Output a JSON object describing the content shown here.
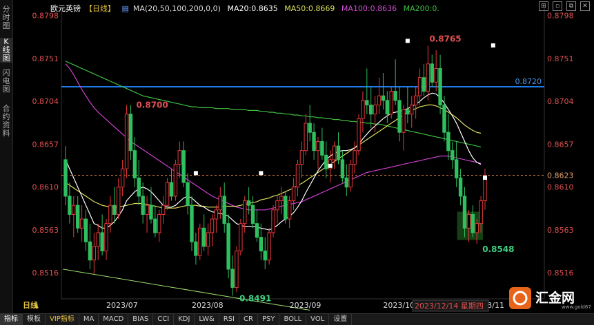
{
  "rail": {
    "items": [
      "分时图",
      "K线图",
      "闪电图",
      "合约资料"
    ],
    "active": 1
  },
  "header": {
    "symbol": "欧元英镑",
    "period": "【日线】",
    "ma_params": "MA(20,50,100,200,0,0)",
    "ma20": "MA20:0.8635",
    "ma50": "MA50:0.8669",
    "ma100": "MA100:0.8636",
    "ma200": "MA200:0."
  },
  "colors": {
    "up": "#e8383a",
    "down": "#2fbf5f",
    "ma20": "#ffffff",
    "ma50": "#e0e060",
    "ma100": "#d040d0",
    "ma200": "#40c040",
    "hline": "#1e7be8",
    "cur": "#e08040",
    "axis_text": "#e05050",
    "header_ma20": "#ffffff",
    "header_ma50": "#e0e060",
    "header_ma100": "#d050d0",
    "header_ma200": "#40c040"
  },
  "axis": {
    "y_ticks": [
      "0.8798",
      "0.8751",
      "0.8704",
      "0.8657",
      "0.8610",
      "0.8563",
      "0.8516"
    ],
    "y_min": 0.8489,
    "y_max": 0.8806,
    "x_labels": [
      "2023/07",
      "2023/08",
      "2023/09",
      "2023/10",
      "2023/11"
    ],
    "x_positions_idx": [
      10,
      31,
      55,
      78,
      100
    ],
    "period_label": "日线",
    "cursor_date": "2023/12/14 星期四"
  },
  "annotations": {
    "high_label": "0.8765",
    "low_label": "0.8491",
    "recent_low_label": "0.8548",
    "peak_label": "0.8700",
    "hline_label": "0.8720",
    "hline_value": 0.872,
    "current_label": "0.8623",
    "current_value": 0.8623
  },
  "chart_data": {
    "type": "candlestick",
    "ohlc": [
      [
        0.864,
        0.8655,
        0.859,
        0.86
      ],
      [
        0.86,
        0.8615,
        0.857,
        0.858
      ],
      [
        0.858,
        0.86,
        0.8555,
        0.859
      ],
      [
        0.859,
        0.86,
        0.856,
        0.8565
      ],
      [
        0.8565,
        0.859,
        0.855,
        0.8575
      ],
      [
        0.8575,
        0.8585,
        0.854,
        0.855
      ],
      [
        0.855,
        0.857,
        0.852,
        0.853
      ],
      [
        0.853,
        0.856,
        0.8515,
        0.8545
      ],
      [
        0.8545,
        0.857,
        0.853,
        0.856
      ],
      [
        0.856,
        0.858,
        0.8535,
        0.854
      ],
      [
        0.854,
        0.8575,
        0.853,
        0.857
      ],
      [
        0.857,
        0.86,
        0.856,
        0.859
      ],
      [
        0.859,
        0.861,
        0.857,
        0.858
      ],
      [
        0.858,
        0.862,
        0.8575,
        0.861
      ],
      [
        0.861,
        0.864,
        0.86,
        0.863
      ],
      [
        0.863,
        0.87,
        0.862,
        0.869
      ],
      [
        0.869,
        0.87,
        0.864,
        0.865
      ],
      [
        0.865,
        0.8665,
        0.861,
        0.862
      ],
      [
        0.862,
        0.864,
        0.859,
        0.86
      ],
      [
        0.86,
        0.8615,
        0.857,
        0.858
      ],
      [
        0.858,
        0.86,
        0.856,
        0.859
      ],
      [
        0.859,
        0.861,
        0.857,
        0.8575
      ],
      [
        0.8575,
        0.859,
        0.8555,
        0.856
      ],
      [
        0.856,
        0.8585,
        0.855,
        0.858
      ],
      [
        0.858,
        0.86,
        0.857,
        0.859
      ],
      [
        0.859,
        0.862,
        0.8585,
        0.8615
      ],
      [
        0.8615,
        0.863,
        0.8595,
        0.86
      ],
      [
        0.86,
        0.864,
        0.8595,
        0.8635
      ],
      [
        0.8635,
        0.866,
        0.862,
        0.865
      ],
      [
        0.865,
        0.866,
        0.861,
        0.8615
      ],
      [
        0.8615,
        0.8625,
        0.858,
        0.859
      ],
      [
        0.859,
        0.86,
        0.854,
        0.855
      ],
      [
        0.855,
        0.856,
        0.8525,
        0.8535
      ],
      [
        0.8535,
        0.857,
        0.853,
        0.8565
      ],
      [
        0.8565,
        0.858,
        0.854,
        0.8545
      ],
      [
        0.8545,
        0.857,
        0.8535,
        0.856
      ],
      [
        0.856,
        0.858,
        0.8545,
        0.8575
      ],
      [
        0.8575,
        0.859,
        0.856,
        0.8585
      ],
      [
        0.8585,
        0.861,
        0.8575,
        0.86
      ],
      [
        0.86,
        0.8615,
        0.856,
        0.857
      ],
      [
        0.857,
        0.858,
        0.851,
        0.852
      ],
      [
        0.852,
        0.8535,
        0.8491,
        0.85
      ],
      [
        0.85,
        0.8545,
        0.8495,
        0.854
      ],
      [
        0.854,
        0.8575,
        0.8535,
        0.857
      ],
      [
        0.857,
        0.86,
        0.856,
        0.8595
      ],
      [
        0.8595,
        0.861,
        0.858,
        0.859
      ],
      [
        0.859,
        0.86,
        0.8565,
        0.857
      ],
      [
        0.857,
        0.8585,
        0.855,
        0.8555
      ],
      [
        0.8555,
        0.857,
        0.853,
        0.854
      ],
      [
        0.854,
        0.8555,
        0.852,
        0.853
      ],
      [
        0.853,
        0.8565,
        0.8525,
        0.856
      ],
      [
        0.856,
        0.859,
        0.8555,
        0.8585
      ],
      [
        0.8585,
        0.86,
        0.857,
        0.8595
      ],
      [
        0.8595,
        0.861,
        0.858,
        0.86
      ],
      [
        0.86,
        0.8605,
        0.857,
        0.8575
      ],
      [
        0.8575,
        0.86,
        0.8565,
        0.8595
      ],
      [
        0.8595,
        0.862,
        0.8585,
        0.861
      ],
      [
        0.861,
        0.864,
        0.86,
        0.8635
      ],
      [
        0.8635,
        0.866,
        0.862,
        0.865
      ],
      [
        0.865,
        0.869,
        0.8645,
        0.868
      ],
      [
        0.868,
        0.87,
        0.866,
        0.867
      ],
      [
        0.867,
        0.868,
        0.864,
        0.865
      ],
      [
        0.865,
        0.8665,
        0.863,
        0.866
      ],
      [
        0.866,
        0.8675,
        0.864,
        0.8645
      ],
      [
        0.8645,
        0.866,
        0.862,
        0.863
      ],
      [
        0.863,
        0.865,
        0.8615,
        0.864
      ],
      [
        0.864,
        0.866,
        0.863,
        0.8655
      ],
      [
        0.8655,
        0.867,
        0.8635,
        0.864
      ],
      [
        0.864,
        0.865,
        0.8615,
        0.862
      ],
      [
        0.862,
        0.8635,
        0.86,
        0.861
      ],
      [
        0.861,
        0.864,
        0.8605,
        0.8635
      ],
      [
        0.8635,
        0.866,
        0.8625,
        0.865
      ],
      [
        0.865,
        0.869,
        0.8645,
        0.8685
      ],
      [
        0.8685,
        0.8715,
        0.867,
        0.8705
      ],
      [
        0.8705,
        0.874,
        0.869,
        0.87
      ],
      [
        0.87,
        0.872,
        0.8675,
        0.869
      ],
      [
        0.869,
        0.871,
        0.867,
        0.87
      ],
      [
        0.87,
        0.873,
        0.869,
        0.871
      ],
      [
        0.871,
        0.8735,
        0.8695,
        0.8705
      ],
      [
        0.8705,
        0.8715,
        0.868,
        0.869
      ],
      [
        0.869,
        0.872,
        0.8685,
        0.8715
      ],
      [
        0.8715,
        0.875,
        0.87,
        0.8705
      ],
      [
        0.8705,
        0.872,
        0.866,
        0.867
      ],
      [
        0.867,
        0.87,
        0.865,
        0.8695
      ],
      [
        0.8695,
        0.872,
        0.868,
        0.869
      ],
      [
        0.869,
        0.871,
        0.8675,
        0.87
      ],
      [
        0.87,
        0.872,
        0.8685,
        0.871
      ],
      [
        0.871,
        0.874,
        0.87,
        0.873
      ],
      [
        0.873,
        0.8745,
        0.871,
        0.8715
      ],
      [
        0.8715,
        0.8765,
        0.8705,
        0.8745
      ],
      [
        0.8745,
        0.8755,
        0.872,
        0.8725
      ],
      [
        0.8725,
        0.876,
        0.8715,
        0.874
      ],
      [
        0.874,
        0.8755,
        0.869,
        0.87
      ],
      [
        0.87,
        0.871,
        0.866,
        0.867
      ],
      [
        0.867,
        0.869,
        0.864,
        0.865
      ],
      [
        0.865,
        0.866,
        0.863,
        0.864
      ],
      [
        0.864,
        0.866,
        0.861,
        0.862
      ],
      [
        0.862,
        0.863,
        0.859,
        0.86
      ],
      [
        0.86,
        0.861,
        0.8555,
        0.8565
      ],
      [
        0.8565,
        0.8585,
        0.855,
        0.858
      ],
      [
        0.858,
        0.859,
        0.8555,
        0.856
      ],
      [
        0.856,
        0.8575,
        0.8548,
        0.857
      ],
      [
        0.857,
        0.86,
        0.856,
        0.8595
      ],
      [
        0.8595,
        0.863,
        0.8585,
        0.8623
      ]
    ],
    "ma20": [
      0.864,
      0.863,
      0.862,
      0.861,
      0.86,
      0.859,
      0.858,
      0.857,
      0.8568,
      0.8565,
      0.8565,
      0.8568,
      0.8572,
      0.8578,
      0.8585,
      0.8595,
      0.86,
      0.8605,
      0.8608,
      0.861,
      0.8608,
      0.8605,
      0.86,
      0.8595,
      0.859,
      0.8588,
      0.8588,
      0.859,
      0.8594,
      0.8598,
      0.86,
      0.8598,
      0.8594,
      0.859,
      0.8588,
      0.8585,
      0.8583,
      0.8582,
      0.8581,
      0.858,
      0.8578,
      0.8574,
      0.857,
      0.8568,
      0.8567,
      0.8567,
      0.8567,
      0.8566,
      0.8565,
      0.8564,
      0.8563,
      0.8565,
      0.8568,
      0.8572,
      0.8575,
      0.8578,
      0.8582,
      0.8588,
      0.8595,
      0.8604,
      0.8612,
      0.862,
      0.8628,
      0.8634,
      0.864,
      0.8644,
      0.8647,
      0.8649,
      0.865,
      0.865,
      0.8651,
      0.8653,
      0.8657,
      0.8663,
      0.8668,
      0.8673,
      0.8677,
      0.8681,
      0.8685,
      0.8688,
      0.8691,
      0.8692,
      0.8693,
      0.8694,
      0.8696,
      0.8698,
      0.8701,
      0.8704,
      0.8708,
      0.8711,
      0.8713,
      0.8712,
      0.8708,
      0.8702,
      0.8695,
      0.8688,
      0.868,
      0.867,
      0.866,
      0.865,
      0.8642,
      0.8637,
      0.8635
    ],
    "ma50": [
      0.8615,
      0.8612,
      0.8609,
      0.8606,
      0.8603,
      0.86,
      0.8597,
      0.8594,
      0.8592,
      0.859,
      0.8589,
      0.8588,
      0.8588,
      0.8588,
      0.8589,
      0.859,
      0.8591,
      0.8592,
      0.8592,
      0.8592,
      0.8591,
      0.859,
      0.8589,
      0.8588,
      0.8587,
      0.8587,
      0.8587,
      0.8587,
      0.8588,
      0.8589,
      0.859,
      0.859,
      0.859,
      0.8589,
      0.8589,
      0.8588,
      0.8588,
      0.8588,
      0.8588,
      0.8589,
      0.8589,
      0.8589,
      0.8589,
      0.859,
      0.8591,
      0.8592,
      0.8593,
      0.8594,
      0.8596,
      0.8597,
      0.8598,
      0.86,
      0.8601,
      0.8603,
      0.8605,
      0.8607,
      0.8609,
      0.8612,
      0.8614,
      0.8617,
      0.862,
      0.8623,
      0.8626,
      0.8629,
      0.8632,
      0.8635,
      0.8638,
      0.8641,
      0.8644,
      0.8647,
      0.865,
      0.8653,
      0.8656,
      0.8659,
      0.8662,
      0.8665,
      0.8668,
      0.8671,
      0.8674,
      0.8677,
      0.868,
      0.8683,
      0.8686,
      0.8689,
      0.8692,
      0.8694,
      0.8696,
      0.8698,
      0.8699,
      0.87,
      0.87,
      0.8699,
      0.8697,
      0.8695,
      0.8692,
      0.8689,
      0.8686,
      0.8682,
      0.8678,
      0.8675,
      0.8672,
      0.867,
      0.8669
    ],
    "ma100": [
      0.8745,
      0.874,
      0.8733,
      0.8725,
      0.8717,
      0.871,
      0.8703,
      0.8697,
      0.8692,
      0.8688,
      0.8684,
      0.868,
      0.8676,
      0.8672,
      0.8668,
      0.8664,
      0.866,
      0.8657,
      0.8654,
      0.8651,
      0.8648,
      0.8645,
      0.8642,
      0.8639,
      0.8636,
      0.8633,
      0.863,
      0.8627,
      0.8624,
      0.8621,
      0.8618,
      0.8615,
      0.8612,
      0.8609,
      0.8606,
      0.8603,
      0.86,
      0.8598,
      0.8596,
      0.8594,
      0.8592,
      0.859,
      0.8588,
      0.8587,
      0.8586,
      0.8585,
      0.8585,
      0.8585,
      0.8585,
      0.8585,
      0.8586,
      0.8587,
      0.8588,
      0.8589,
      0.859,
      0.8591,
      0.8592,
      0.8593,
      0.8594,
      0.8596,
      0.8598,
      0.86,
      0.8602,
      0.8604,
      0.8606,
      0.8608,
      0.861,
      0.8612,
      0.8614,
      0.8616,
      0.8618,
      0.862,
      0.8622,
      0.8624,
      0.8626,
      0.8627,
      0.8628,
      0.8629,
      0.863,
      0.8631,
      0.8632,
      0.8633,
      0.8634,
      0.8635,
      0.8636,
      0.8637,
      0.8638,
      0.8639,
      0.864,
      0.8641,
      0.8642,
      0.8643,
      0.8644,
      0.8644,
      0.8644,
      0.8643,
      0.8642,
      0.8641,
      0.864,
      0.8639,
      0.8638,
      0.8637,
      0.8636
    ],
    "ma200": [
      0.8748,
      0.8746,
      0.8744,
      0.8742,
      0.874,
      0.8738,
      0.8736,
      0.8734,
      0.8732,
      0.873,
      0.8728,
      0.8726,
      0.8724,
      0.8722,
      0.872,
      0.8718,
      0.8716,
      0.8714,
      0.8712,
      0.871,
      0.8709,
      0.8708,
      0.8707,
      0.8706,
      0.8705,
      0.8704,
      0.8703,
      0.8702,
      0.8701,
      0.87,
      0.8699,
      0.8698,
      0.8698,
      0.8697,
      0.8697,
      0.8697,
      0.8697,
      0.8696,
      0.8696,
      0.8696,
      0.8696,
      0.8695,
      0.8695,
      0.8695,
      0.8695,
      0.8694,
      0.8694,
      0.8694,
      0.8693,
      0.8693,
      0.8692,
      0.8692,
      0.8691,
      0.8691,
      0.869,
      0.869,
      0.8689,
      0.8689,
      0.8688,
      0.8688,
      0.8687,
      0.8687,
      0.8686,
      0.8686,
      0.8685,
      0.8685,
      0.8684,
      0.8684,
      0.8683,
      0.8683,
      0.8682,
      0.8682,
      0.8681,
      0.8681,
      0.868,
      0.868,
      0.8679,
      0.8679,
      0.8678,
      0.8677,
      0.8676,
      0.8675,
      0.8674,
      0.8673,
      0.8672,
      0.8671,
      0.867,
      0.8669,
      0.8668,
      0.8667,
      0.8666,
      0.8665,
      0.8664,
      0.8663,
      0.8662,
      0.8661,
      0.866,
      0.8659,
      0.8658,
      0.8657,
      0.8656,
      0.8655,
      0.8654
    ],
    "trendline_values": [
      0.852,
      0.8475
    ]
  },
  "bottom_tabs": [
    "指标",
    "模板",
    "VIP指标",
    "MA",
    "MACD",
    "BIAS",
    "CCI",
    "KDJ",
    "LW&",
    "RSI",
    "CR",
    "PSY",
    "BOLL",
    "VOL",
    "设置"
  ],
  "logo": {
    "text": "汇金网",
    "sub": "www.gold678.com"
  }
}
